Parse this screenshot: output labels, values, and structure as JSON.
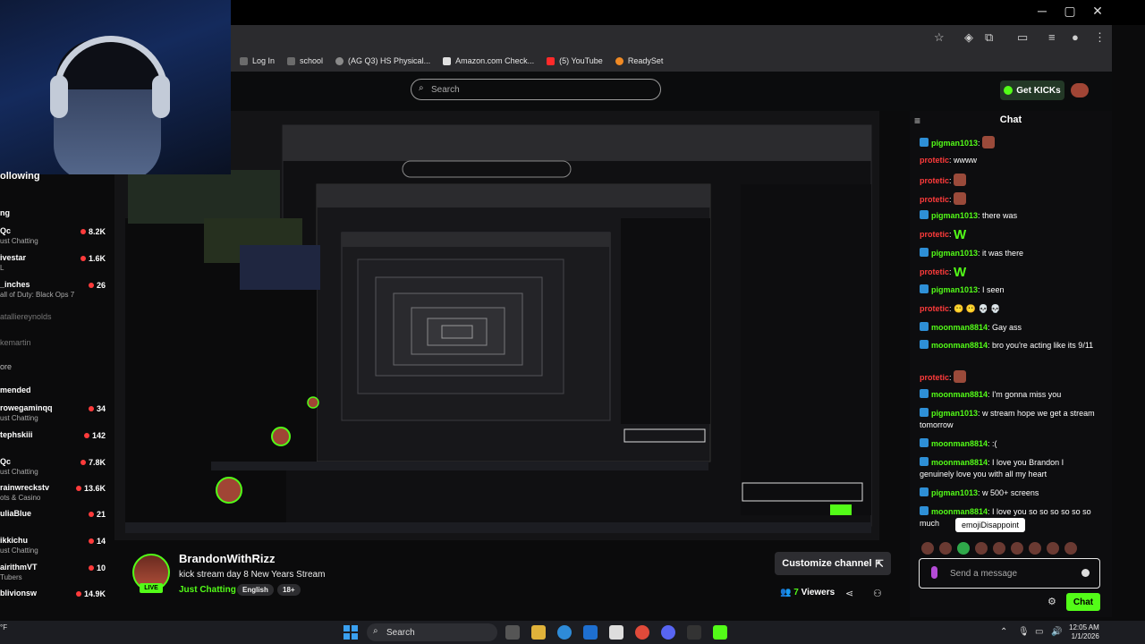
{
  "window": {
    "minimize": "─",
    "maximize": "▢",
    "close": "✕"
  },
  "bookmarks": [
    {
      "label": "Log In",
      "color": "#6b6b6b"
    },
    {
      "label": "school",
      "color": "#6b6b6b"
    },
    {
      "label": "(AG Q3) HS Physical...",
      "color": "#8a8a8a"
    },
    {
      "label": "Amazon.com Check...",
      "color": "#e0e0e0"
    },
    {
      "label": "(5) YouTube",
      "color": "#ff2a2a"
    },
    {
      "label": "ReadySet",
      "color": "#f08a24"
    }
  ],
  "header": {
    "search_placeholder": "Search",
    "get_kicks": "Get KICKs"
  },
  "sidebar": {
    "following_title": "ollowing",
    "section_live": "ng",
    "following": [
      {
        "name": "Qc",
        "sub": "ust Chatting",
        "count": "8.2K"
      },
      {
        "name": "ivestar",
        "sub": "L",
        "count": "1.6K"
      },
      {
        "name": "_inches",
        "sub": "all of Duty: Black Ops 7",
        "count": "26"
      }
    ],
    "offline": [
      "atalliereynolds",
      "kemartin"
    ],
    "more": "ore",
    "recommended_title": "mended",
    "recommended": [
      {
        "name": "rowegaminqq",
        "sub": "ust Chatting",
        "count": "34"
      },
      {
        "name": "tephskiii",
        "sub": "",
        "count": "142"
      },
      {
        "name": "Qc",
        "sub": "ust Chatting",
        "count": "7.8K"
      },
      {
        "name": "rainwreckstv",
        "sub": "ots & Casino",
        "count": "13.6K"
      },
      {
        "name": "uliaBlue",
        "sub": "",
        "count": "21"
      },
      {
        "name": "ikkichu",
        "sub": "ust Chatting",
        "count": "14"
      },
      {
        "name": "airithmVT",
        "sub": "Tubers",
        "count": "10"
      },
      {
        "name": "blivionsw",
        "sub": "",
        "count": "14.9K"
      }
    ]
  },
  "chat": {
    "title": "Chat",
    "messages": [
      {
        "user": "pigman1013",
        "color": "#53fc18",
        "badge": true,
        "text": "",
        "emote": "face"
      },
      {
        "user": "protetic",
        "color": "#ff3b3b",
        "badge": false,
        "text": "wwww",
        "emote": ""
      },
      {
        "user": "protetic",
        "color": "#ff3b3b",
        "badge": false,
        "text": "",
        "emote": "face"
      },
      {
        "user": "protetic",
        "color": "#ff3b3b",
        "badge": false,
        "text": "",
        "emote": "face"
      },
      {
        "user": "pigman1013",
        "color": "#53fc18",
        "badge": true,
        "text": "there was",
        "emote": ""
      },
      {
        "user": "protetic",
        "color": "#ff3b3b",
        "badge": false,
        "text": "",
        "emote": "W"
      },
      {
        "user": "pigman1013",
        "color": "#53fc18",
        "badge": true,
        "text": "it was there",
        "emote": ""
      },
      {
        "user": "protetic",
        "color": "#ff3b3b",
        "badge": false,
        "text": "",
        "emote": "W"
      },
      {
        "user": "pigman1013",
        "color": "#53fc18",
        "badge": true,
        "text": "I seen",
        "emote": ""
      },
      {
        "user": "protetic",
        "color": "#ff3b3b",
        "badge": false,
        "text": "😶 😶 💀 💀",
        "emote": ""
      },
      {
        "user": "moonman8814",
        "color": "#53fc18",
        "badge": true,
        "text": "Gay ass",
        "emote": ""
      },
      {
        "user": "moonman8814",
        "color": "#53fc18",
        "badge": true,
        "text": "bro you're acting like its 9/11",
        "emote": ""
      },
      {
        "user": "protetic",
        "color": "#ff3b3b",
        "badge": false,
        "text": "",
        "emote": "face"
      },
      {
        "user": "moonman8814",
        "color": "#53fc18",
        "badge": true,
        "text": "I'm gonna miss you",
        "emote": ""
      },
      {
        "user": "pigman1013",
        "color": "#53fc18",
        "badge": true,
        "text": "w stream hope we get a stream tomorrow",
        "emote": ""
      },
      {
        "user": "moonman8814",
        "color": "#53fc18",
        "badge": true,
        "text": ":(",
        "emote": ""
      },
      {
        "user": "moonman8814",
        "color": "#53fc18",
        "badge": true,
        "text": "I love you Brandon I genuinely love you with all my heart",
        "emote": ""
      },
      {
        "user": "pigman1013",
        "color": "#53fc18",
        "badge": true,
        "text": "w 500+ screens",
        "emote": ""
      },
      {
        "user": "moonman8814",
        "color": "#53fc18",
        "badge": true,
        "text": "I love you so so so so so so much",
        "emote": ""
      }
    ],
    "tooltip": "emojiDisappoint",
    "send_placeholder": "Send a message",
    "send_button": "Chat"
  },
  "stream": {
    "streamer": "BrandonWithRizz",
    "title": "kick stream day 8 New Years Stream",
    "category": "Just Chatting",
    "tags": [
      "English",
      "18+"
    ],
    "live": "LIVE",
    "customize": "Customize channel",
    "viewers_count": "7",
    "viewers_label": "Viewers"
  },
  "taskbar": {
    "search": "Search",
    "time": "12:05 AM",
    "date": "1/1/2026",
    "weather": "°F"
  }
}
